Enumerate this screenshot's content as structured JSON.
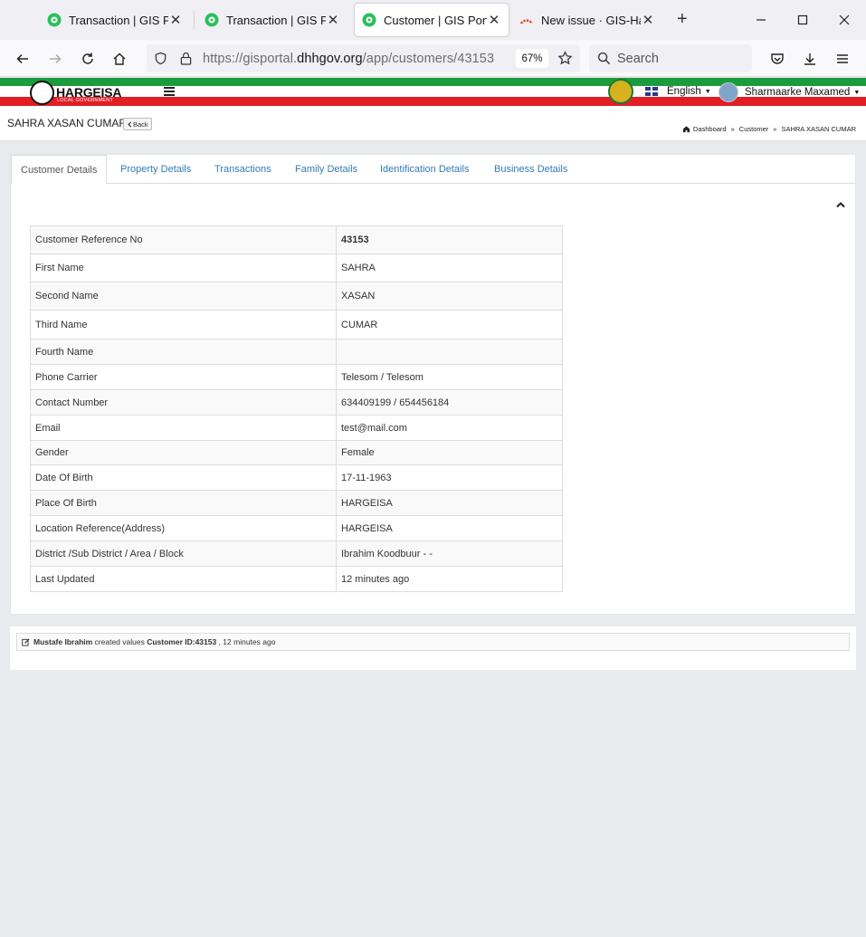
{
  "browser": {
    "tabs": [
      {
        "title": "Transaction | GIS Portal",
        "active": false
      },
      {
        "title": "Transaction | GIS Portal",
        "active": false
      },
      {
        "title": "Customer | GIS Portal",
        "active": true
      },
      {
        "title": "New issue · GIS-Hargeisa",
        "active": false
      }
    ],
    "url_prefix": "https://gisportal.",
    "url_domain": "dhhgov.org",
    "url_path": "/app/customers/43153",
    "zoom": "67%",
    "search_placeholder": "Search"
  },
  "header": {
    "logo_text": "HARGEISA",
    "logo_subtext": "LOCAL GOVERNMENT",
    "language": "English",
    "user_name": "Sharmaarke Maxamed",
    "brand_green": "#1a9c3d",
    "brand_red": "#e21d24"
  },
  "titlebar": {
    "title": "SAHRA XASAN CUMAR",
    "back_label": "Back",
    "breadcrumb": [
      "Dashboard",
      "Customer",
      "SAHRA XASAN CUMAR"
    ]
  },
  "panel": {
    "tabs": [
      "Customer Details",
      "Property Details",
      "Transactions",
      "Family Details",
      "Identification Details",
      "Business Details"
    ],
    "active_tab": "Customer Details",
    "rows": [
      {
        "label": "Customer Reference No",
        "value": "43153"
      },
      {
        "label": "First Name",
        "value": "SAHRA"
      },
      {
        "label": "Second Name",
        "value": "XASAN"
      },
      {
        "label": "Third Name",
        "value": "CUMAR"
      },
      {
        "label": "Fourth Name",
        "value": ""
      },
      {
        "label": "Phone Carrier",
        "value": "Telesom / Telesom"
      },
      {
        "label": "Contact Number",
        "value": "634409199 / 654456184"
      },
      {
        "label": "Email",
        "value": "test@mail.com"
      },
      {
        "label": "Gender",
        "value": "Female"
      },
      {
        "label": "Date Of Birth",
        "value": "17-11-1963"
      },
      {
        "label": "Place Of Birth",
        "value": "HARGEISA"
      },
      {
        "label": "Location Reference(Address)",
        "value": "HARGEISA"
      },
      {
        "label": "District /Sub District / Area / Block",
        "value": "Ibrahim Koodbuur - -"
      },
      {
        "label": "Last Updated",
        "value": "12 minutes ago"
      }
    ]
  },
  "activity": {
    "user": "Mustafe Ibrahim",
    "action": " created values ",
    "target": "Customer ID:43153",
    "time": " , 12 minutes ago"
  }
}
